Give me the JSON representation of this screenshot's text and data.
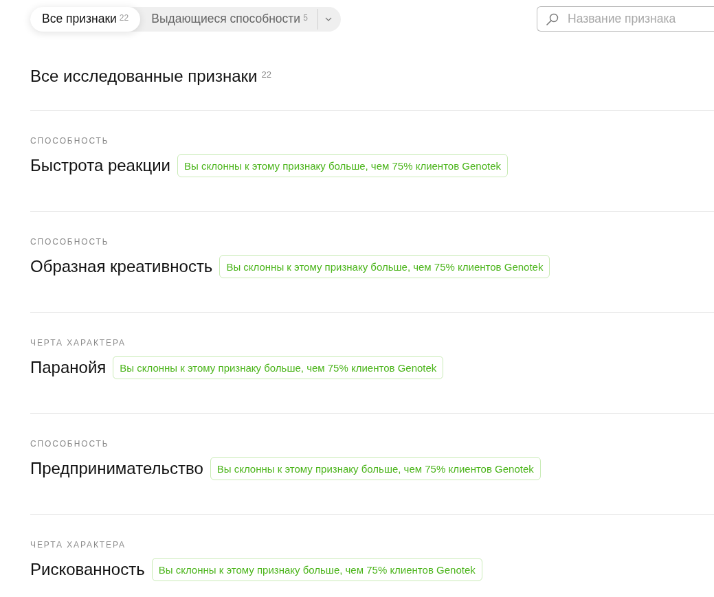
{
  "tabs": [
    {
      "label": "Все признаки",
      "count": "22",
      "selected": true
    },
    {
      "label": "Выдающиеся способности",
      "count": "5",
      "selected": false
    }
  ],
  "search": {
    "placeholder": "Название признака"
  },
  "heading": {
    "title": "Все исследованные признаки",
    "count": "22"
  },
  "traits": [
    {
      "category": "СПОСОБНОСТЬ",
      "name": "Быстрота реакции",
      "badge": "Вы склонны к этому признаку больше, чем 75% клиентов Genotek"
    },
    {
      "category": "СПОСОБНОСТЬ",
      "name": "Образная креативность",
      "badge": "Вы склонны к этому признаку больше, чем 75% клиентов Genotek"
    },
    {
      "category": "ЧЕРТА ХАРАКТЕРА",
      "name": "Паранойя",
      "badge": "Вы склонны к этому признаку больше, чем 75% клиентов Genotek"
    },
    {
      "category": "СПОСОБНОСТЬ",
      "name": "Предпринимательство",
      "badge": "Вы склонны к этому признаку больше, чем 75% клиентов Genotek"
    },
    {
      "category": "ЧЕРТА ХАРАКТЕРА",
      "name": "Рискованность",
      "badge": "Вы склонны к этому признаку больше, чем 75% клиентов Genotek"
    }
  ]
}
